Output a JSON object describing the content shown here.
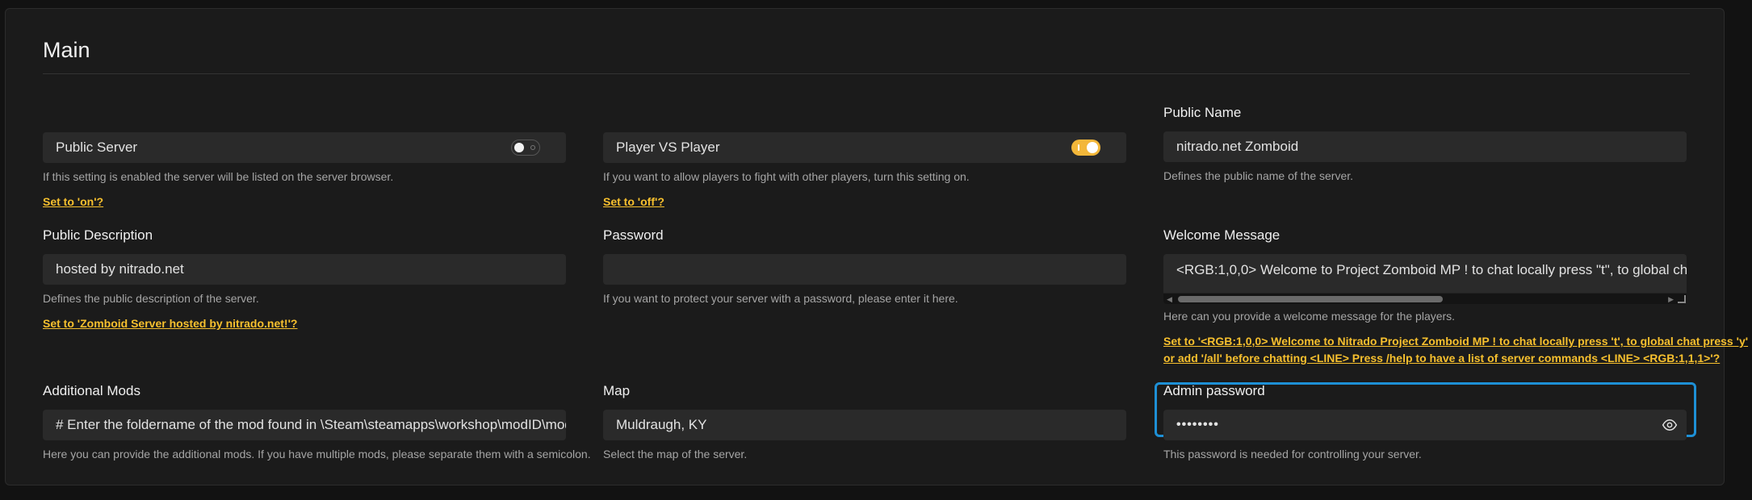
{
  "section": {
    "title": "Main"
  },
  "public_server": {
    "label": "Public Server",
    "help": "If this setting is enabled the server will be listed on the server browser.",
    "suggestion": "Set to 'on'?"
  },
  "pvp": {
    "label": "Player VS Player",
    "help": "If you want to allow players to fight with other players, turn this setting on.",
    "suggestion": "Set to 'off'?"
  },
  "public_name": {
    "label": "Public Name",
    "value": "nitrado.net Zomboid",
    "help": "Defines the public name of the server."
  },
  "public_description": {
    "label": "Public Description",
    "value": "hosted by nitrado.net",
    "help": "Defines the public description of the server.",
    "suggestion": "Set to 'Zomboid Server hosted by nitrado.net!'?"
  },
  "password": {
    "label": "Password",
    "value": "",
    "help": "If you want to protect your server with a password, please enter it here."
  },
  "welcome_message": {
    "label": "Welcome Message",
    "value": "<RGB:1,0,0> Welcome to Project Zomboid MP ! to chat locally press \"t\", to global chat press \"y",
    "help": "Here can you provide a welcome message for the players.",
    "suggestion_line1": "Set to '<RGB:1,0,0> Welcome to Nitrado Project Zomboid MP ! to chat locally press 't', to global chat press 'y'",
    "suggestion_line2": "or add '/all' before chatting <LINE> Press /help to have a list of server commands <LINE> <RGB:1,1,1>'?"
  },
  "additional_mods": {
    "label": "Additional Mods",
    "value": "# Enter the foldername of the mod found in \\Steam\\steamapps\\workshop\\modID\\mods\\m",
    "help": "Here you can provide the additional mods. If you have multiple mods, please separate them with a semicolon."
  },
  "map": {
    "label": "Map",
    "value": "Muldraugh, KY",
    "help": "Select the map of the server."
  },
  "admin_password": {
    "label": "Admin password",
    "value": "••••••••",
    "help": "This password is needed for controlling your server."
  },
  "icons": {
    "toggle_off": "toggle-off-icon",
    "toggle_on": "toggle-on-icon",
    "reveal": "eye-icon"
  },
  "colors": {
    "accent": "#f7c02e",
    "focus": "#1e90d6",
    "toggle_on": "#f3b73a"
  }
}
